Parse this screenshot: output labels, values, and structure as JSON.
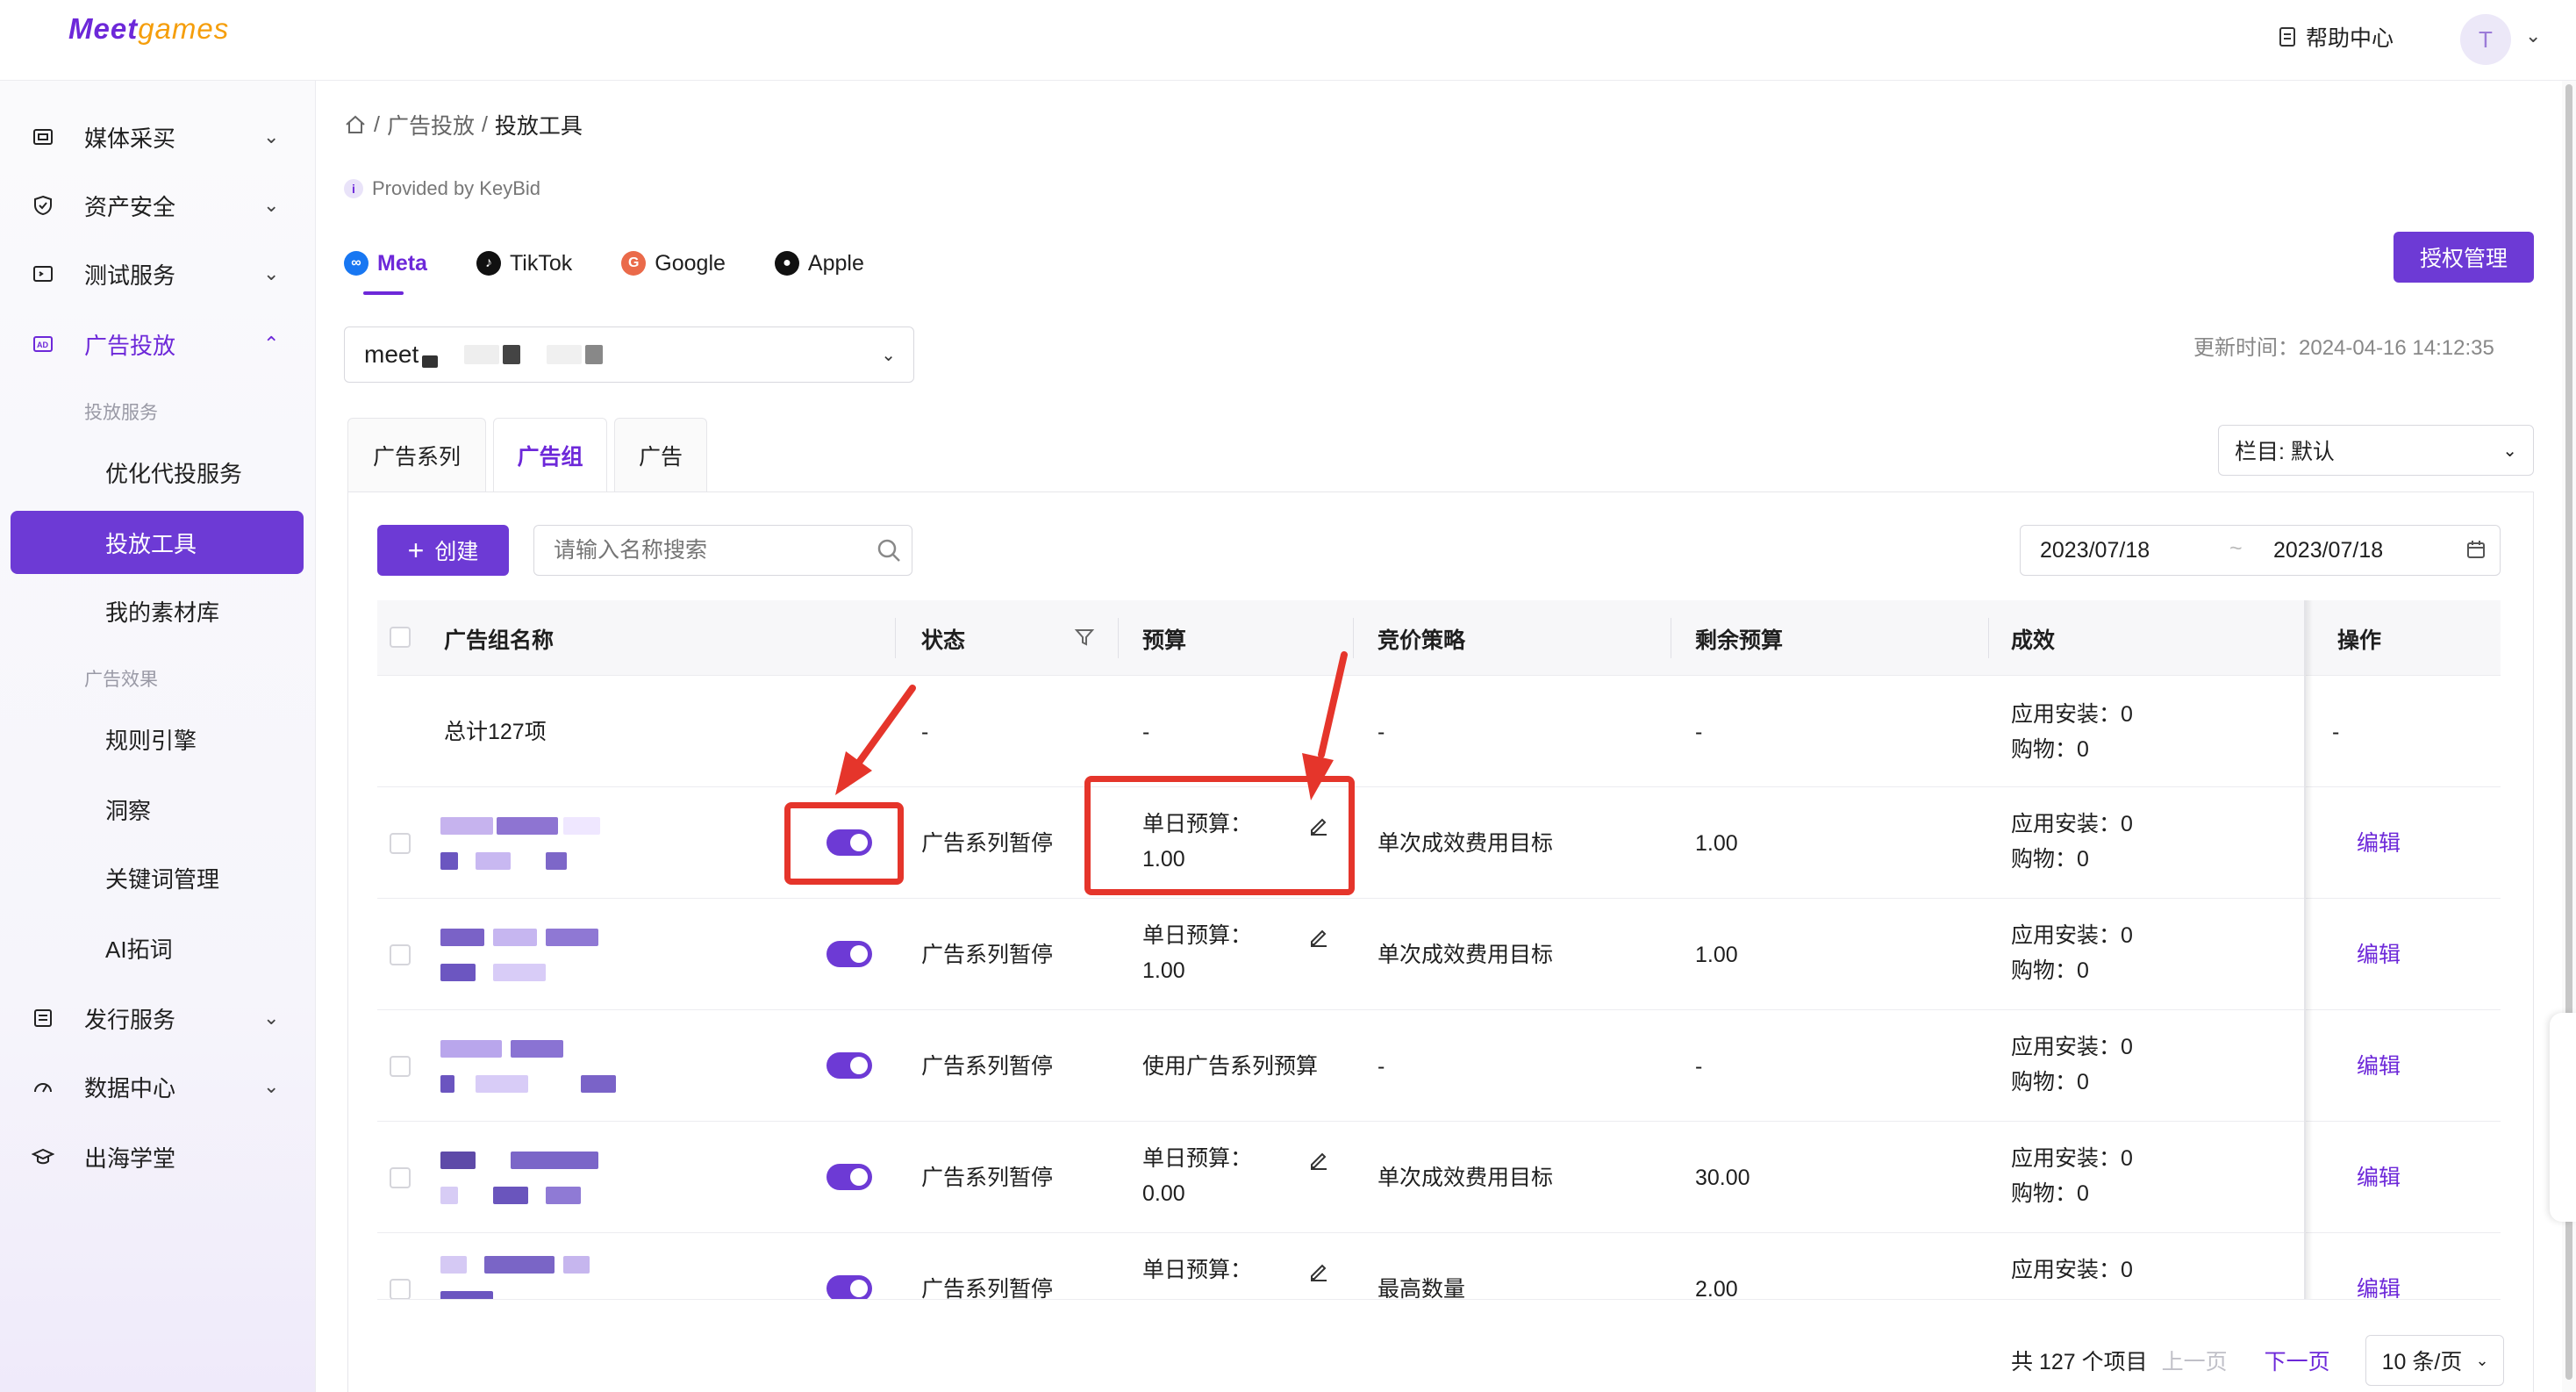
{
  "brand": {
    "logo_main": "Meet",
    "logo_sub": "games"
  },
  "header": {
    "help_label": "帮助中心",
    "avatar_letter": "T"
  },
  "sidebar": {
    "items": [
      {
        "label": "媒体采买",
        "icon": "media-buy-icon"
      },
      {
        "label": "资产安全",
        "icon": "shield-icon"
      },
      {
        "label": "测试服务",
        "icon": "test-icon"
      },
      {
        "label": "广告投放",
        "icon": "ad-icon"
      },
      {
        "label": "发行服务",
        "icon": "publish-icon"
      },
      {
        "label": "数据中心",
        "icon": "data-icon"
      },
      {
        "label": "出海学堂",
        "icon": "academy-icon"
      }
    ],
    "group_delivery": "投放服务",
    "sub_optimize": "优化代投服务",
    "sub_tool": "投放工具",
    "sub_material": "我的素材库",
    "group_effect": "广告效果",
    "sub_rules": "规则引擎",
    "sub_insight": "洞察",
    "sub_keywords": "关键词管理",
    "sub_ai": "AI拓词"
  },
  "breadcrumb": {
    "sep": "/",
    "parent": "广告投放",
    "current": "投放工具"
  },
  "provided_by": "Provided by KeyBid",
  "platforms": [
    {
      "label": "Meta",
      "icon": "meta-icon",
      "color": "#1877f2"
    },
    {
      "label": "TikTok",
      "icon": "tiktok-icon",
      "color": "#111111"
    },
    {
      "label": "Google",
      "icon": "google-icon",
      "color": "#ea4335"
    },
    {
      "label": "Apple",
      "icon": "apple-icon",
      "color": "#111111"
    }
  ],
  "auth_button": "授权管理",
  "account": {
    "value": "meet"
  },
  "updated": "更新时间：2024-04-16 14:12:35",
  "level_tabs": [
    "广告系列",
    "广告组",
    "广告"
  ],
  "columns_select": "栏目: 默认",
  "toolbar": {
    "create_label": "创建",
    "search_placeholder": "请输入名称搜索"
  },
  "date_range": {
    "start": "2023/07/18",
    "end": "2023/07/18"
  },
  "table": {
    "headers": [
      "广告组名称",
      "状态",
      "预算",
      "竞价策略",
      "剩余预算",
      "成效",
      "操作"
    ],
    "summary": {
      "name": "总计127项",
      "status": "-",
      "budget": "-",
      "bid": "-",
      "remaining": "-",
      "result1": "应用安装：0",
      "result2": "购物：0",
      "action": "-"
    },
    "rows": [
      {
        "status": "广告系列暂停",
        "budget1": "单日预算：",
        "budget2": "1.00",
        "bid": "单次成效费用目标",
        "remaining": "1.00",
        "result1": "应用安装：0",
        "result2": "购物：0",
        "action": "编辑"
      },
      {
        "status": "广告系列暂停",
        "budget1": "单日预算：",
        "budget2": "1.00",
        "bid": "单次成效费用目标",
        "remaining": "1.00",
        "result1": "应用安装：0",
        "result2": "购物：0",
        "action": "编辑"
      },
      {
        "status": "广告系列暂停",
        "budget1": "使用广告系列预算",
        "budget2": "",
        "bid": "-",
        "remaining": "-",
        "result1": "应用安装：0",
        "result2": "购物：0",
        "action": "编辑"
      },
      {
        "status": "广告系列暂停",
        "budget1": "单日预算：",
        "budget2": "0.00",
        "bid": "单次成效费用目标",
        "remaining": "30.00",
        "result1": "应用安装：0",
        "result2": "购物：0",
        "action": "编辑"
      },
      {
        "status": "广告系列暂停",
        "budget1": "单日预算：",
        "budget2": "",
        "bid": "最高数量",
        "remaining": "2.00",
        "result1": "应用安装：0",
        "result2": "",
        "action": "编辑"
      }
    ]
  },
  "pagination": {
    "total": "共 127 个项目",
    "prev": "上一页",
    "next": "下一页",
    "page_size": "10 条/页"
  },
  "colors": {
    "accent": "#6d3ad5",
    "annotation": "#e5352b"
  }
}
